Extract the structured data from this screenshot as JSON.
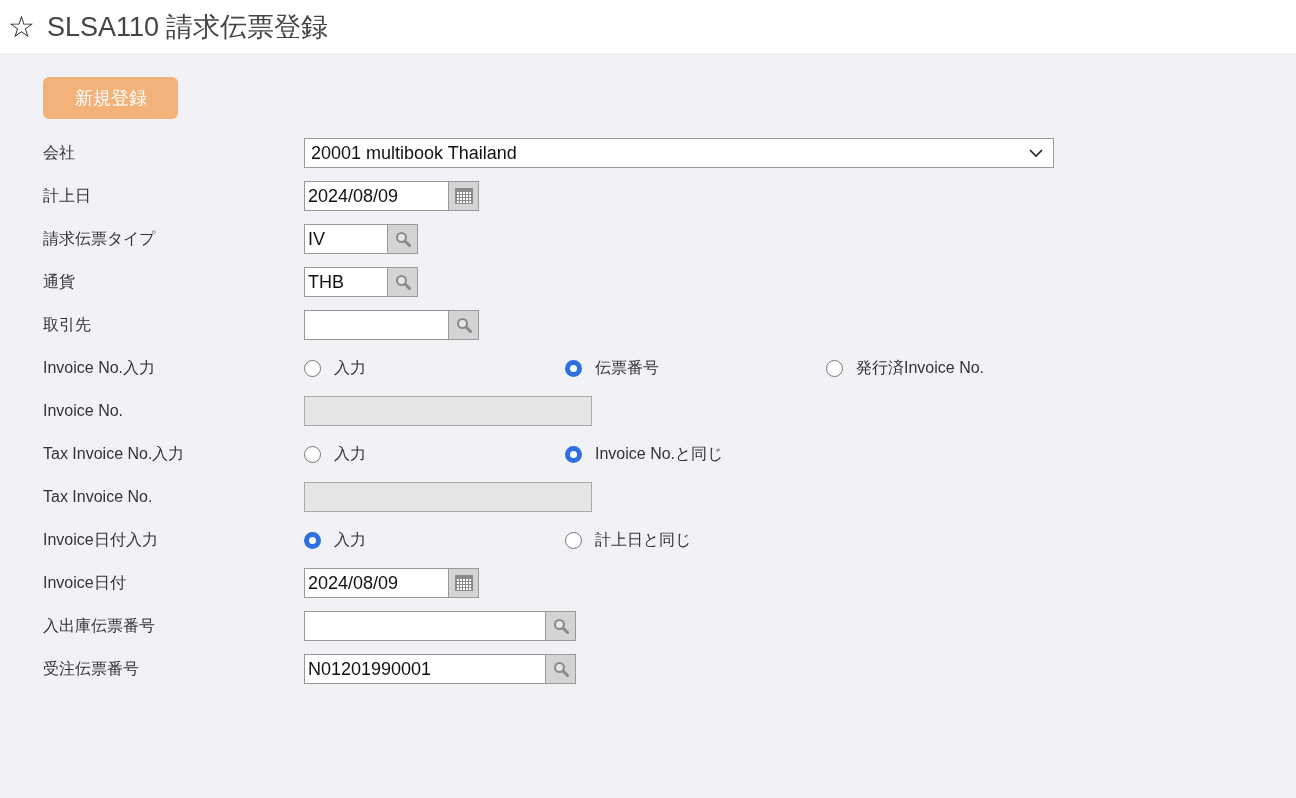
{
  "header": {
    "star": "☆",
    "title": "SLSA110 請求伝票登録"
  },
  "new_button": {
    "label": "新規登録"
  },
  "fields": [
    {
      "kind": "select",
      "label": "会社",
      "value": "20001 multibook Thailand"
    },
    {
      "kind": "date",
      "label": "計上日",
      "value": "2024/08/09"
    },
    {
      "kind": "lookup",
      "label": "請求伝票タイプ",
      "value": "IV"
    },
    {
      "kind": "lookup",
      "label": "通貨",
      "value": "THB"
    },
    {
      "kind": "lookup",
      "label": "取引先"
    },
    {
      "kind": "radio",
      "label": "Invoice No.入力",
      "options": [
        {
          "label": "入力",
          "selected": false
        },
        {
          "label": "伝票番号",
          "selected": true
        },
        {
          "label": "発行済Invoice No.",
          "selected": false
        }
      ]
    },
    {
      "kind": "disabled",
      "label": "Invoice No."
    },
    {
      "kind": "radio",
      "label": "Tax Invoice No.入力",
      "options": [
        {
          "label": "入力",
          "selected": false
        },
        {
          "label": "Invoice No.と同じ",
          "selected": true
        }
      ]
    },
    {
      "kind": "disabled",
      "label": "Tax Invoice No."
    },
    {
      "kind": "radio",
      "label": "Invoice日付入力",
      "options": [
        {
          "label": "入力",
          "selected": true
        },
        {
          "label": "計上日と同じ",
          "selected": false
        }
      ]
    },
    {
      "kind": "date",
      "label": "Invoice日付",
      "value": "2024/08/09"
    },
    {
      "kind": "lookup",
      "label": "入出庫伝票番号"
    },
    {
      "kind": "lookup",
      "label": "受注伝票番号",
      "value": "N01201990001"
    }
  ]
}
